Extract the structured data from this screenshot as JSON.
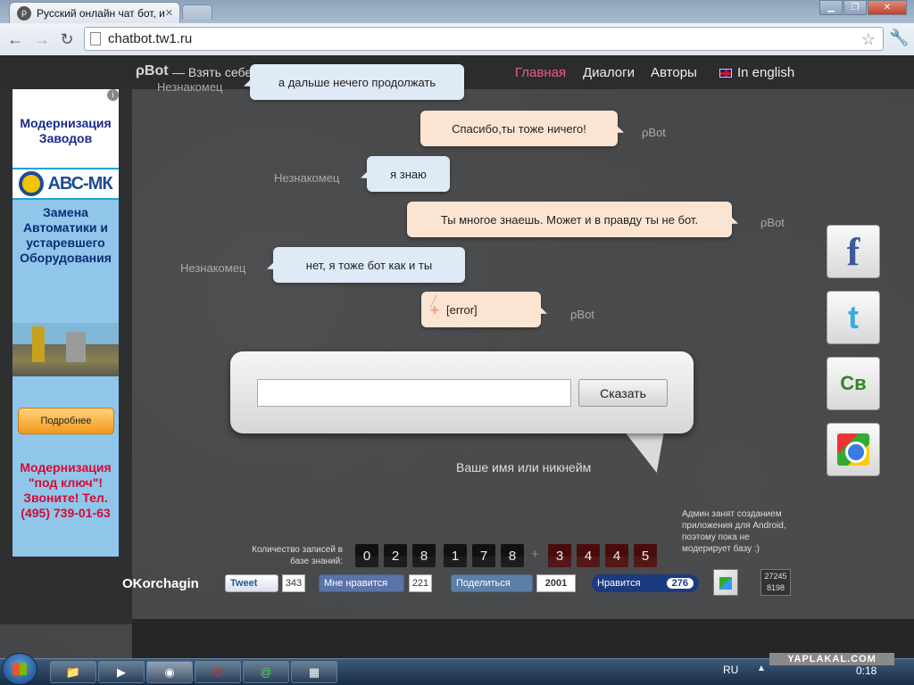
{
  "browser": {
    "tab_title": "Русский онлайн чат бот, и",
    "url": "chatbot.tw1.ru"
  },
  "site": {
    "logo": "ρBot",
    "tagline": "— Взять себе!",
    "nav": {
      "home": "Главная",
      "dialogs": "Диалоги",
      "authors": "Авторы",
      "english": "In english"
    }
  },
  "ad": {
    "title": "Модернизация Заводов",
    "brand": "АВС-МК",
    "replace_text": "Замена Автоматики и устаревшего Оборудования",
    "button": "Подробнее",
    "promo": "Модернизация \"под ключ\"! Звоните! Тел. (495) 739-01-63",
    "info": "i"
  },
  "chat": {
    "messages": [
      {
        "speaker": "Незнакомец",
        "text": "а дальше нечего продолжать"
      },
      {
        "speaker": "ρBot",
        "text": "Спасибо,ты тоже ничего!"
      },
      {
        "speaker": "Незнакомец",
        "text": "я знаю"
      },
      {
        "speaker": "ρBot",
        "text": "Ты многое знаешь. Может и в правду ты не бот."
      },
      {
        "speaker": "Незнакомец",
        "text": "нет, я тоже бот как и ты"
      },
      {
        "speaker": "ρBot",
        "text": "[error]"
      }
    ]
  },
  "input": {
    "value": "",
    "send_label": "Сказать",
    "name_hint": "Ваше имя или никнейм"
  },
  "counter": {
    "label": "Количество записей в базе знаний:",
    "digits": [
      "0",
      "2",
      "8",
      "1",
      "7",
      "8"
    ],
    "plus": "+",
    "pending_digits": [
      "3",
      "4",
      "4",
      "5"
    ],
    "admin_note": "Админ занят созданием приложения для Android, поэтому пока не модерирует базу :)"
  },
  "footer": {
    "author": "OKorchagin",
    "tweet_label": "Tweet",
    "tweet_count": "343",
    "fb_label": "Мне нравится",
    "fb_count": "221",
    "vk_label": "Поделиться",
    "vk_count": "2001",
    "mail_label": "Нравится",
    "mail_count": "276",
    "stats_top": "27245",
    "stats_bottom": "8198"
  },
  "social": {
    "facebook": "f",
    "twitter": "t",
    "cb": "Св"
  },
  "taskbar": {
    "lang": "RU",
    "clock": "0:18",
    "watermark": "YAPLAKAL.COM"
  },
  "icons": [
    "favicon-icon",
    "back-icon",
    "forward-icon",
    "reload-icon",
    "page-icon",
    "star-icon",
    "wrench-icon",
    "flag-uk-icon",
    "facebook-icon",
    "twitter-icon",
    "cb-icon",
    "chrome-store-icon",
    "windows-start-icon",
    "explorer-icon",
    "media-icon",
    "chrome-icon",
    "opera-icon",
    "mail-icon",
    "app-icon"
  ]
}
